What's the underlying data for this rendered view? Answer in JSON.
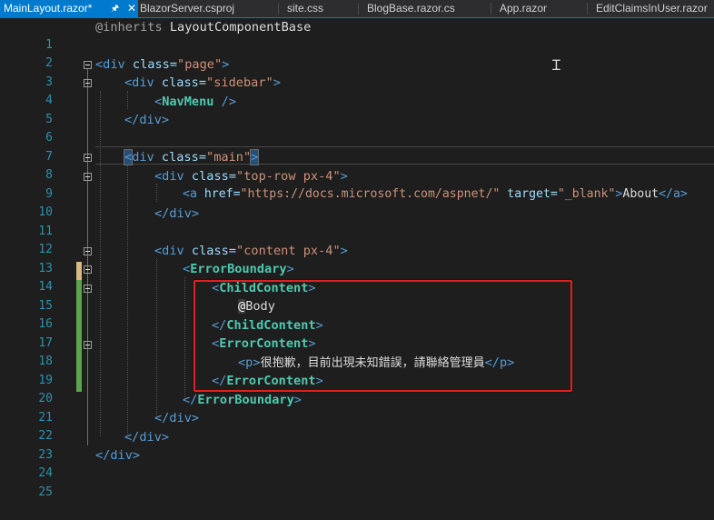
{
  "tabs": [
    {
      "label": "MainLayout.razor*",
      "active": true,
      "pin_icon": "pin-icon",
      "close_icon": "close-icon"
    },
    {
      "label": "BlazorServer.csproj"
    },
    {
      "label": "site.css"
    },
    {
      "label": "BlogBase.razor.cs"
    },
    {
      "label": "App.razor"
    },
    {
      "label": "EditClaimsInUser.razor"
    }
  ],
  "colors": {
    "accent": "#007acc",
    "line_numbers": "#2b91af",
    "tag": "#569cd6",
    "attribute": "#9cdcfe",
    "string": "#ce9178",
    "component": "#4ec9b0",
    "highlight_box": "#e02020",
    "change_saved": "#57a64a",
    "change_unsaved": "#d7ba7d"
  },
  "editor": {
    "line_numbers": [
      "1",
      "2",
      "3",
      "4",
      "5",
      "6",
      "7",
      "8",
      "9",
      "10",
      "11",
      "12",
      "13",
      "14",
      "15",
      "16",
      "17",
      "18",
      "19",
      "20",
      "21",
      "22",
      "23",
      "24",
      "25"
    ],
    "lines": {
      "l1": {
        "a": "@inherits",
        "b": " LayoutComponentBase"
      },
      "l3": {
        "open": "<div",
        "attr": " class=",
        "val": "\"page\"",
        "close": ">"
      },
      "l4": {
        "open": "<div",
        "attr": " class=",
        "val": "\"sidebar\"",
        "close": ">"
      },
      "l5": {
        "open": "<",
        "comp": "NavMenu",
        "close": " />"
      },
      "l6": {
        "tag": "</div>"
      },
      "l8": {
        "open": "<",
        "name": "div",
        "attr": " class=",
        "val": "\"main\"",
        "close": ">"
      },
      "l9": {
        "open": "<div",
        "attr": " class=",
        "val": "\"top-row px-4\"",
        "close": ">"
      },
      "l10": {
        "open": "<a",
        "attr1": " href=",
        "val1": "\"https://docs.microsoft.com/aspnet/\"",
        "attr2": " target=",
        "val2": "\"_blank\"",
        "gt": ">",
        "text": "About",
        "close": "</a>"
      },
      "l11": {
        "tag": "</div>"
      },
      "l13": {
        "open": "<div",
        "attr": " class=",
        "val": "\"content px-4\"",
        "close": ">"
      },
      "l14": {
        "open": "<",
        "comp": "ErrorBoundary",
        "close": ">"
      },
      "l15": {
        "open": "<",
        "comp": "ChildContent",
        "close": ">"
      },
      "l16": {
        "at": "@",
        "text": "Body"
      },
      "l17": {
        "open": "</",
        "comp": "ChildContent",
        "close": ">"
      },
      "l18": {
        "open": "<",
        "comp": "ErrorContent",
        "close": ">"
      },
      "l19": {
        "open": "<p>",
        "text": "很抱歉，目前出現未知錯誤，請聯絡管理員",
        "close": "</p>"
      },
      "l20": {
        "open": "</",
        "comp": "ErrorContent",
        "close": ">"
      },
      "l21": {
        "open": "</",
        "comp": "ErrorBoundary",
        "close": ">"
      },
      "l22": {
        "tag": "</div>"
      },
      "l23": {
        "tag": "</div>"
      },
      "l24": {
        "tag": "</div>"
      }
    }
  }
}
